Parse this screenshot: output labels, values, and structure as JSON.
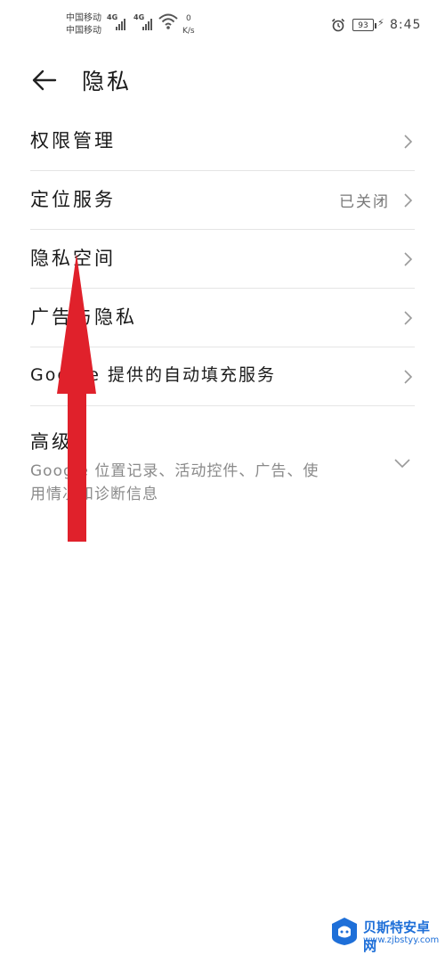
{
  "status_bar": {
    "carrier1": "中国移动",
    "carrier2": "中国移动",
    "net1": "4G",
    "net2": "4G",
    "speed_value": "0",
    "speed_unit": "K/s",
    "battery": "93",
    "time": "8:45"
  },
  "header": {
    "title": "隐私",
    "back_icon": "back-arrow-icon"
  },
  "items": [
    {
      "label": "权限管理",
      "value": ""
    },
    {
      "label": "定位服务",
      "value": "已关闭"
    },
    {
      "label": "隐私空间",
      "value": ""
    },
    {
      "label": "广告与隐私",
      "value": ""
    },
    {
      "label": "Google 提供的自动填充服务",
      "value": ""
    }
  ],
  "advanced": {
    "label": "高级",
    "summary": "Google 位置记录、活动控件、广告、使用情况和诊断信息"
  },
  "annotation": {
    "color": "#e0212b"
  },
  "watermark": {
    "title": "贝斯特安卓网",
    "url": "www.zjbstyy.com"
  }
}
